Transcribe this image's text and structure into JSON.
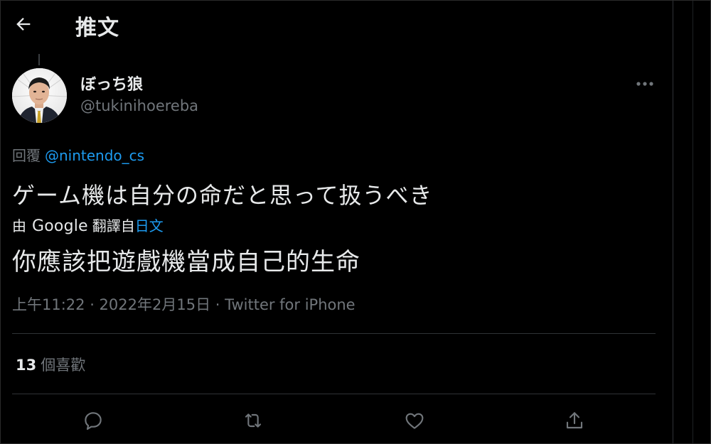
{
  "header": {
    "title": "推文"
  },
  "author": {
    "name": "ぼっち狼",
    "handle": "@tukinihoereba"
  },
  "reply": {
    "prefix": "回覆",
    "mention": "@nintendo_cs"
  },
  "tweet": {
    "text": "ゲーム機は自分の命だと思って扱うべき",
    "translation": {
      "by_prefix": "由",
      "provider": "Google",
      "by_suffix": "翻譯自",
      "source_lang": "日文",
      "text": "你應該把遊戲機當成自己的生命"
    },
    "timestamp": "上午11:22 · 2022年2月15日 · ",
    "source": "Twitter for iPhone"
  },
  "stats": {
    "likes_count": "13",
    "likes_label": "個喜歡"
  },
  "icons": {
    "back": "arrow-left-icon",
    "more": "more-horizontal-icon",
    "reply": "reply-bubble-icon",
    "retweet": "retweet-icon",
    "like": "heart-icon",
    "share": "share-icon"
  },
  "colors": {
    "background": "#000000",
    "text": "#e7e9ea",
    "secondary": "#71767b",
    "link": "#1d9bf0",
    "divider": "#2f3336"
  }
}
